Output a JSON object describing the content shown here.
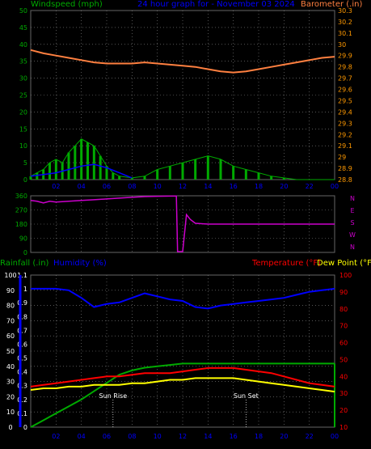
{
  "header": {
    "windspeed_label": "Windspeed (mph)",
    "title": "24 hour graph for - November 03 2024",
    "barometer_label": "Barometer (.in)"
  },
  "lower_header": {
    "rainfall_label": "Rainfall (.in)",
    "humidity_label": "Humidity (%)",
    "temperature_label": "Temperature (°F)",
    "dewpoint_label": "Dew Point (°F)"
  },
  "colors": {
    "wind": "#00aa00",
    "wind_avg": "#0000ff",
    "barometer": "#ff8040",
    "direction": "#cc00cc",
    "rainfall": "#00aa00",
    "humidity": "#0000ff",
    "temperature": "#ff0000",
    "dewpoint": "#ffff00",
    "axis_left": "#00aa00",
    "axis_right": "#ff9900",
    "axis_temp": "#ff0000",
    "axis_humidity": "#0000ff"
  },
  "chart_data": [
    {
      "type": "line",
      "name": "wind_barometer",
      "x_ticks": [
        "02",
        "04",
        "06",
        "08",
        "10",
        "12",
        "14",
        "16",
        "18",
        "20",
        "22",
        "00"
      ],
      "y_left_ticks": [
        "0",
        "5",
        "10",
        "15",
        "20",
        "25",
        "30",
        "35",
        "40",
        "45",
        "50"
      ],
      "y_right_ticks": [
        "28.8",
        "28.9",
        "29",
        "29.1",
        "29.2",
        "29.3",
        "29.4",
        "29.5",
        "29.6",
        "29.7",
        "29.8",
        "29.9",
        "30",
        "30.1",
        "30.2",
        "30.3"
      ],
      "ylim_left": [
        0,
        50
      ],
      "ylim_right": [
        28.8,
        30.3
      ],
      "xlim": [
        0,
        24
      ],
      "series": [
        {
          "name": "Barometer (.in)",
          "axis": "right",
          "x": [
            0,
            1,
            2,
            3,
            4,
            5,
            6,
            7,
            8,
            9,
            10,
            11,
            12,
            13,
            14,
            15,
            16,
            17,
            18,
            19,
            20,
            21,
            22,
            23,
            24
          ],
          "values": [
            29.95,
            29.92,
            29.9,
            29.88,
            29.86,
            29.84,
            29.83,
            29.83,
            29.83,
            29.84,
            29.83,
            29.82,
            29.81,
            29.8,
            29.78,
            29.76,
            29.75,
            29.76,
            29.78,
            29.8,
            29.82,
            29.84,
            29.86,
            29.88,
            29.89
          ]
        },
        {
          "name": "Windspeed (mph)",
          "axis": "left",
          "x": [
            0,
            0.5,
            1,
            1.5,
            2,
            2.5,
            3,
            3.5,
            4,
            4.5,
            5,
            5.5,
            6,
            6.5,
            7,
            8,
            9,
            10,
            11,
            12,
            13,
            14,
            15,
            16,
            17,
            18,
            19,
            20,
            21,
            22,
            23,
            24
          ],
          "values": [
            1,
            2,
            3,
            5,
            6,
            5,
            8,
            10,
            12,
            11,
            10,
            7,
            4,
            2,
            1,
            0.5,
            1,
            3,
            4,
            5,
            6,
            7,
            6,
            4,
            3,
            2,
            1,
            0.5,
            0,
            0,
            0,
            0
          ]
        },
        {
          "name": "avg",
          "axis": "left",
          "x": [
            0,
            1,
            2,
            3,
            4,
            5,
            6,
            7,
            8
          ],
          "values": [
            1,
            1.5,
            2,
            3,
            4,
            4.5,
            3.5,
            2,
            0.5
          ]
        }
      ]
    },
    {
      "type": "line",
      "name": "wind_direction",
      "x_ticks": [
        "02",
        "04",
        "06",
        "08",
        "10",
        "12",
        "14",
        "16",
        "18",
        "20",
        "22",
        "00"
      ],
      "y_left_ticks": [
        "0",
        "90",
        "180",
        "270",
        "360"
      ],
      "y_right_ticks": [
        "N",
        "E",
        "S",
        "W",
        "N"
      ],
      "ylim": [
        0,
        360
      ],
      "xlim": [
        0,
        24
      ],
      "series": [
        {
          "name": "direction",
          "x": [
            0,
            0.5,
            1,
            1.5,
            2,
            3,
            4,
            5,
            6,
            7,
            8,
            9,
            10,
            11,
            11.5,
            11.6,
            12,
            12.3,
            12.6,
            13,
            14,
            15,
            16,
            17,
            18,
            19,
            20,
            21,
            22,
            23,
            24
          ],
          "values": [
            330,
            325,
            315,
            325,
            320,
            325,
            330,
            335,
            340,
            345,
            350,
            355,
            357,
            358,
            358,
            5,
            5,
            240,
            210,
            185,
            180,
            180,
            180,
            180,
            180,
            180,
            180,
            180,
            180,
            180,
            180
          ]
        }
      ]
    },
    {
      "type": "line",
      "name": "rain_humidity_temp",
      "x_ticks": [
        "02",
        "04",
        "06",
        "08",
        "10",
        "12",
        "14",
        "16",
        "18",
        "20",
        "22",
        "00"
      ],
      "y_left_ticks": [
        "0",
        "10",
        "20",
        "30",
        "40",
        "50",
        "60",
        "70",
        "80",
        "90",
        "100"
      ],
      "y_rain_ticks": [
        "0",
        "0.1",
        "0.2",
        "0.3",
        "0.4",
        "0.5",
        "0.6",
        "0.7",
        "0.8",
        "0.9",
        "1",
        "1.1"
      ],
      "y_right_ticks": [
        "10",
        "20",
        "30",
        "40",
        "50",
        "60",
        "70",
        "80",
        "90",
        "100"
      ],
      "ylim_humidity": [
        0,
        100
      ],
      "ylim_rain": [
        0,
        1.1
      ],
      "ylim_temp": [
        10,
        100
      ],
      "xlim": [
        0,
        24
      ],
      "annotations": [
        {
          "text": "Sun Rise",
          "x": 6.5
        },
        {
          "text": "Sun Set",
          "x": 17.0
        }
      ],
      "series": [
        {
          "name": "Rainfall (.in)",
          "axis": "rain",
          "x": [
            0,
            1,
            2,
            3,
            4,
            5,
            6,
            7,
            8,
            9,
            10,
            11,
            12,
            24
          ],
          "values": [
            0,
            0.05,
            0.1,
            0.15,
            0.2,
            0.26,
            0.32,
            0.38,
            0.41,
            0.43,
            0.44,
            0.45,
            0.46,
            0.46
          ]
        },
        {
          "name": "Humidity (%)",
          "axis": "humidity",
          "x": [
            0,
            1,
            2,
            3,
            4,
            5,
            6,
            7,
            8,
            9,
            10,
            11,
            12,
            13,
            14,
            15,
            16,
            17,
            18,
            19,
            20,
            21,
            22,
            23,
            24
          ],
          "values": [
            91,
            91,
            91,
            90,
            85,
            79,
            81,
            82,
            85,
            88,
            86,
            84,
            83,
            79,
            78,
            80,
            81,
            82,
            83,
            84,
            85,
            87,
            89,
            90,
            91
          ]
        },
        {
          "name": "Temperature (°F)",
          "axis": "temp",
          "x": [
            0,
            1,
            2,
            3,
            4,
            5,
            6,
            7,
            8,
            9,
            10,
            11,
            12,
            13,
            14,
            15,
            16,
            17,
            18,
            19,
            20,
            21,
            22,
            23,
            24
          ],
          "values": [
            34,
            35,
            36,
            37,
            38,
            39,
            40,
            40,
            41,
            42,
            42,
            42,
            43,
            44,
            45,
            45,
            45,
            44,
            43,
            42,
            40,
            38,
            36,
            35,
            34
          ]
        },
        {
          "name": "Dew Point (°F)",
          "axis": "temp",
          "x": [
            0,
            1,
            2,
            3,
            4,
            5,
            6,
            7,
            8,
            9,
            10,
            11,
            12,
            13,
            14,
            15,
            16,
            17,
            18,
            19,
            20,
            21,
            22,
            23,
            24
          ],
          "values": [
            32,
            33,
            33,
            34,
            34,
            35,
            35,
            35,
            36,
            36,
            37,
            38,
            38,
            39,
            39,
            39,
            39,
            38,
            37,
            36,
            35,
            34,
            33,
            32,
            31
          ]
        }
      ]
    }
  ]
}
